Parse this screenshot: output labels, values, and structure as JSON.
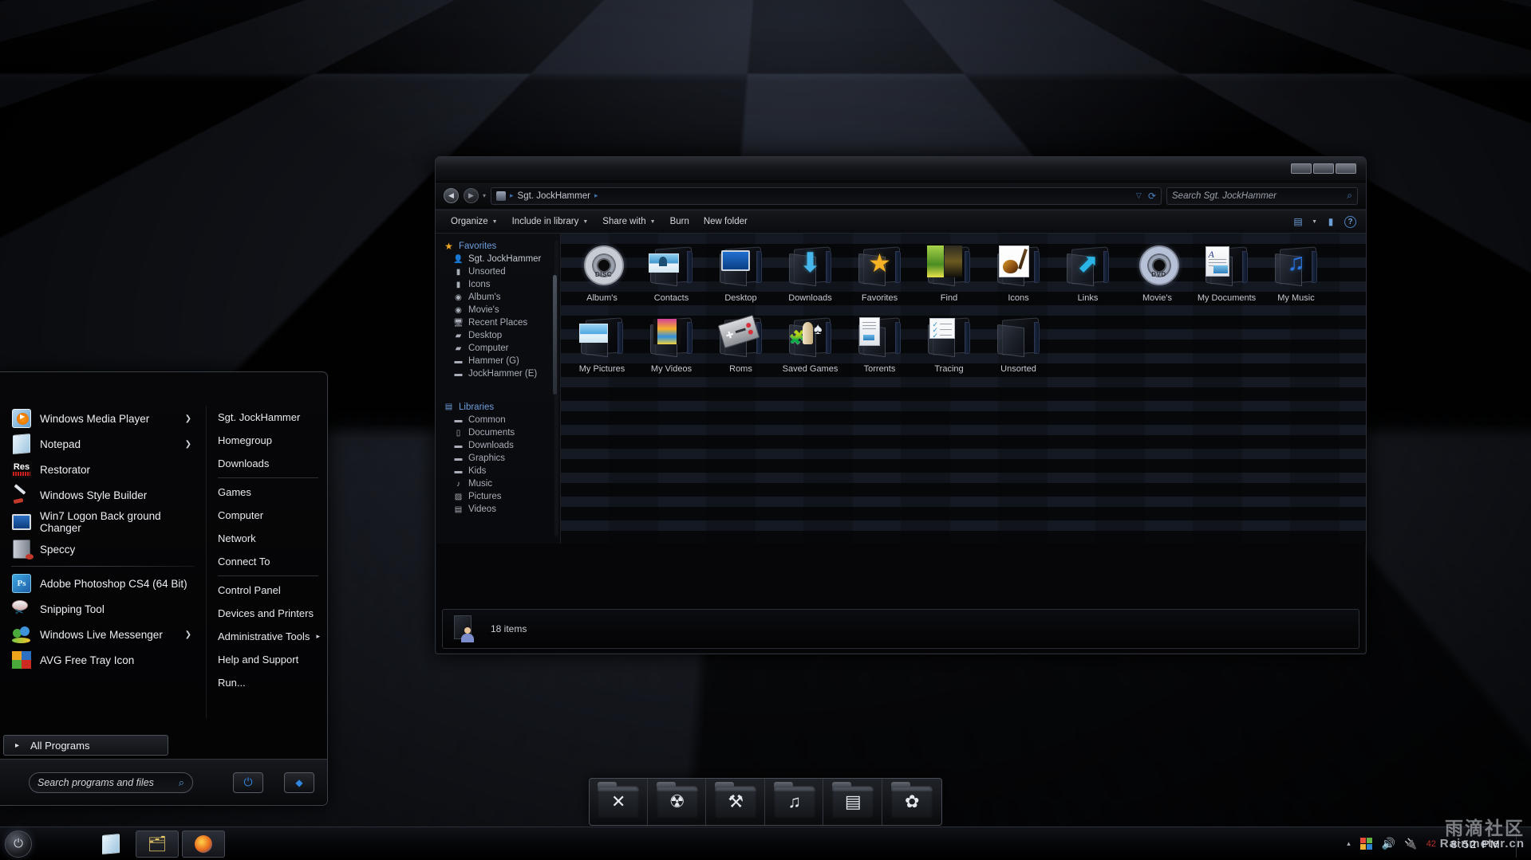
{
  "desktop": {
    "wallpaper_name": "black-checkered-floor"
  },
  "explorer": {
    "window_buttons": [
      "minimize",
      "maximize",
      "close"
    ],
    "address": {
      "back_icon": "back-arrow-icon",
      "forward_icon": "forward-arrow-icon",
      "history_caret": "chevron-down-icon",
      "path_icon": "user-folder-icon",
      "path": "Sgt. JockHammer",
      "sep": "▸",
      "dropdown_caret": "▽",
      "refresh_icon": "refresh-icon"
    },
    "search": {
      "placeholder": "Search Sgt. JockHammer",
      "icon": "magnifier-icon"
    },
    "toolbar": {
      "items": [
        {
          "label": "Organize",
          "caret": true
        },
        {
          "label": "Include in library",
          "caret": true
        },
        {
          "label": "Share with",
          "caret": true
        },
        {
          "label": "Burn",
          "caret": false
        },
        {
          "label": "New folder",
          "caret": false
        }
      ],
      "view_icon": "view-layout-icon",
      "view_caret": "▾",
      "preview_icon": "preview-pane-icon",
      "help_icon": "?"
    },
    "navpane": {
      "sections": [
        {
          "head": {
            "label": "Favorites",
            "icon": "star-icon"
          },
          "items": [
            {
              "label": "Sgt. JockHammer",
              "icon": "user-folder-icon"
            },
            {
              "label": "Unsorted",
              "icon": "folder-icon"
            },
            {
              "label": "Icons",
              "icon": "folder-icon"
            },
            {
              "label": "Album's",
              "icon": "disc-icon"
            },
            {
              "label": "Movie's",
              "icon": "disc-icon"
            },
            {
              "label": "Recent Places",
              "icon": "recent-places-icon"
            },
            {
              "label": "Desktop",
              "icon": "desktop-icon"
            },
            {
              "label": "Computer",
              "icon": "computer-icon"
            },
            {
              "label": "Hammer (G)",
              "icon": "drive-icon"
            },
            {
              "label": "JockHammer (E)",
              "icon": "drive-icon"
            }
          ]
        },
        {
          "head": {
            "label": "Libraries",
            "icon": "libraries-icon"
          },
          "items": [
            {
              "label": "Common",
              "icon": "folder-icon"
            },
            {
              "label": "Documents",
              "icon": "documents-library-icon"
            },
            {
              "label": "Downloads",
              "icon": "folder-icon"
            },
            {
              "label": "Graphics",
              "icon": "folder-icon"
            },
            {
              "label": "Kids",
              "icon": "folder-icon"
            },
            {
              "label": "Music",
              "icon": "music-library-icon"
            },
            {
              "label": "Pictures",
              "icon": "pictures-library-icon"
            },
            {
              "label": "Videos",
              "icon": "videos-library-icon"
            }
          ]
        }
      ]
    },
    "items": [
      {
        "label": "Album's",
        "art": "disc",
        "disc_text": "DISC"
      },
      {
        "label": "Contacts",
        "art": "contacts"
      },
      {
        "label": "Desktop",
        "art": "monitor"
      },
      {
        "label": "Downloads",
        "art": "download-arrow"
      },
      {
        "label": "Favorites",
        "art": "star"
      },
      {
        "label": "Find",
        "art": "covers"
      },
      {
        "label": "Icons",
        "art": "guitar"
      },
      {
        "label": "Links",
        "art": "link-arrow"
      },
      {
        "label": "Movie's",
        "art": "dvd",
        "disc_text": "DVD"
      },
      {
        "label": "My Documents",
        "art": "document"
      },
      {
        "label": "My Music",
        "art": "music-note"
      },
      {
        "label": "My Pictures",
        "art": "picture"
      },
      {
        "label": "My Videos",
        "art": "filmstrip"
      },
      {
        "label": "Roms",
        "art": "gamepad"
      },
      {
        "label": "Saved Games",
        "art": "chess"
      },
      {
        "label": "Torrents",
        "art": "papers"
      },
      {
        "label": "Tracing",
        "art": "checklist"
      },
      {
        "label": "Unsorted",
        "art": "plain"
      }
    ],
    "status": {
      "text": "18 items",
      "icon": "user-folder-icon"
    }
  },
  "start_menu": {
    "left_items": [
      {
        "label": "Windows Media Player",
        "icon": "windows-media-player-icon",
        "arrow": true
      },
      {
        "label": "Notepad",
        "icon": "notepad-icon",
        "arrow": true
      },
      {
        "label": "Restorator",
        "icon": "restorator-icon",
        "arrow": false
      },
      {
        "label": "Windows Style Builder",
        "icon": "windows-style-builder-icon",
        "arrow": false
      },
      {
        "label": "Win7 Logon Back ground Changer",
        "icon": "win7-logon-changer-icon",
        "arrow": false
      },
      {
        "label": "Speccy",
        "icon": "speccy-icon",
        "arrow": false
      },
      {
        "separator": true
      },
      {
        "label": "Adobe Photoshop CS4 (64 Bit)",
        "icon": "photoshop-icon",
        "arrow": false
      },
      {
        "label": "Snipping Tool",
        "icon": "snipping-tool-icon",
        "arrow": false
      },
      {
        "label": "Windows Live Messenger",
        "icon": "windows-live-messenger-icon",
        "arrow": true
      },
      {
        "label": "AVG Free Tray Icon",
        "icon": "avg-icon",
        "arrow": false
      }
    ],
    "all_programs": {
      "label": "All Programs",
      "arrow": "▸"
    },
    "right_items": [
      {
        "label": "Sgt. JockHammer"
      },
      {
        "label": "Homegroup"
      },
      {
        "label": "Downloads"
      },
      {
        "separator": true
      },
      {
        "label": "Games"
      },
      {
        "label": "Computer"
      },
      {
        "label": "Network"
      },
      {
        "label": "Connect To"
      },
      {
        "separator": true
      },
      {
        "label": "Control Panel"
      },
      {
        "label": "Devices and Printers"
      },
      {
        "label": "Administrative Tools",
        "arrow": "▸"
      },
      {
        "label": "Help and Support"
      },
      {
        "label": "Run..."
      }
    ],
    "search": {
      "placeholder": "Search programs and files",
      "icon": "magnifier-icon"
    },
    "power": {
      "icon": "power-icon"
    },
    "power_options": {
      "icon": "shutdown-options-arrow-icon"
    }
  },
  "dock": {
    "items": [
      {
        "name": "x-folder",
        "glyph": "✕"
      },
      {
        "name": "burn-folder",
        "glyph": "☢"
      },
      {
        "name": "tools-folder",
        "glyph": "⚒"
      },
      {
        "name": "music-folder",
        "glyph": "♫"
      },
      {
        "name": "video-folder",
        "glyph": "▤"
      },
      {
        "name": "settings-folder",
        "glyph": "✿"
      }
    ]
  },
  "taskbar": {
    "start_orb": "start-orb-icon",
    "apps": [
      {
        "name": "notepad",
        "icon": "notepad-icon",
        "active": false
      },
      {
        "name": "windows-explorer",
        "icon": "explorer-folder-icon",
        "active": true
      },
      {
        "name": "firefox",
        "icon": "firefox-icon",
        "active": true
      }
    ],
    "tray": {
      "caret": "▴",
      "icons": [
        {
          "name": "windows-flag-icon"
        },
        {
          "name": "volume-icon"
        },
        {
          "name": "power-plug-icon"
        }
      ],
      "number": "42"
    },
    "clock": "8:52 PM",
    "show_desktop": "show-desktop-button"
  },
  "watermark": {
    "cn": "雨滴社区",
    "en": "Rainmeter.cn"
  }
}
